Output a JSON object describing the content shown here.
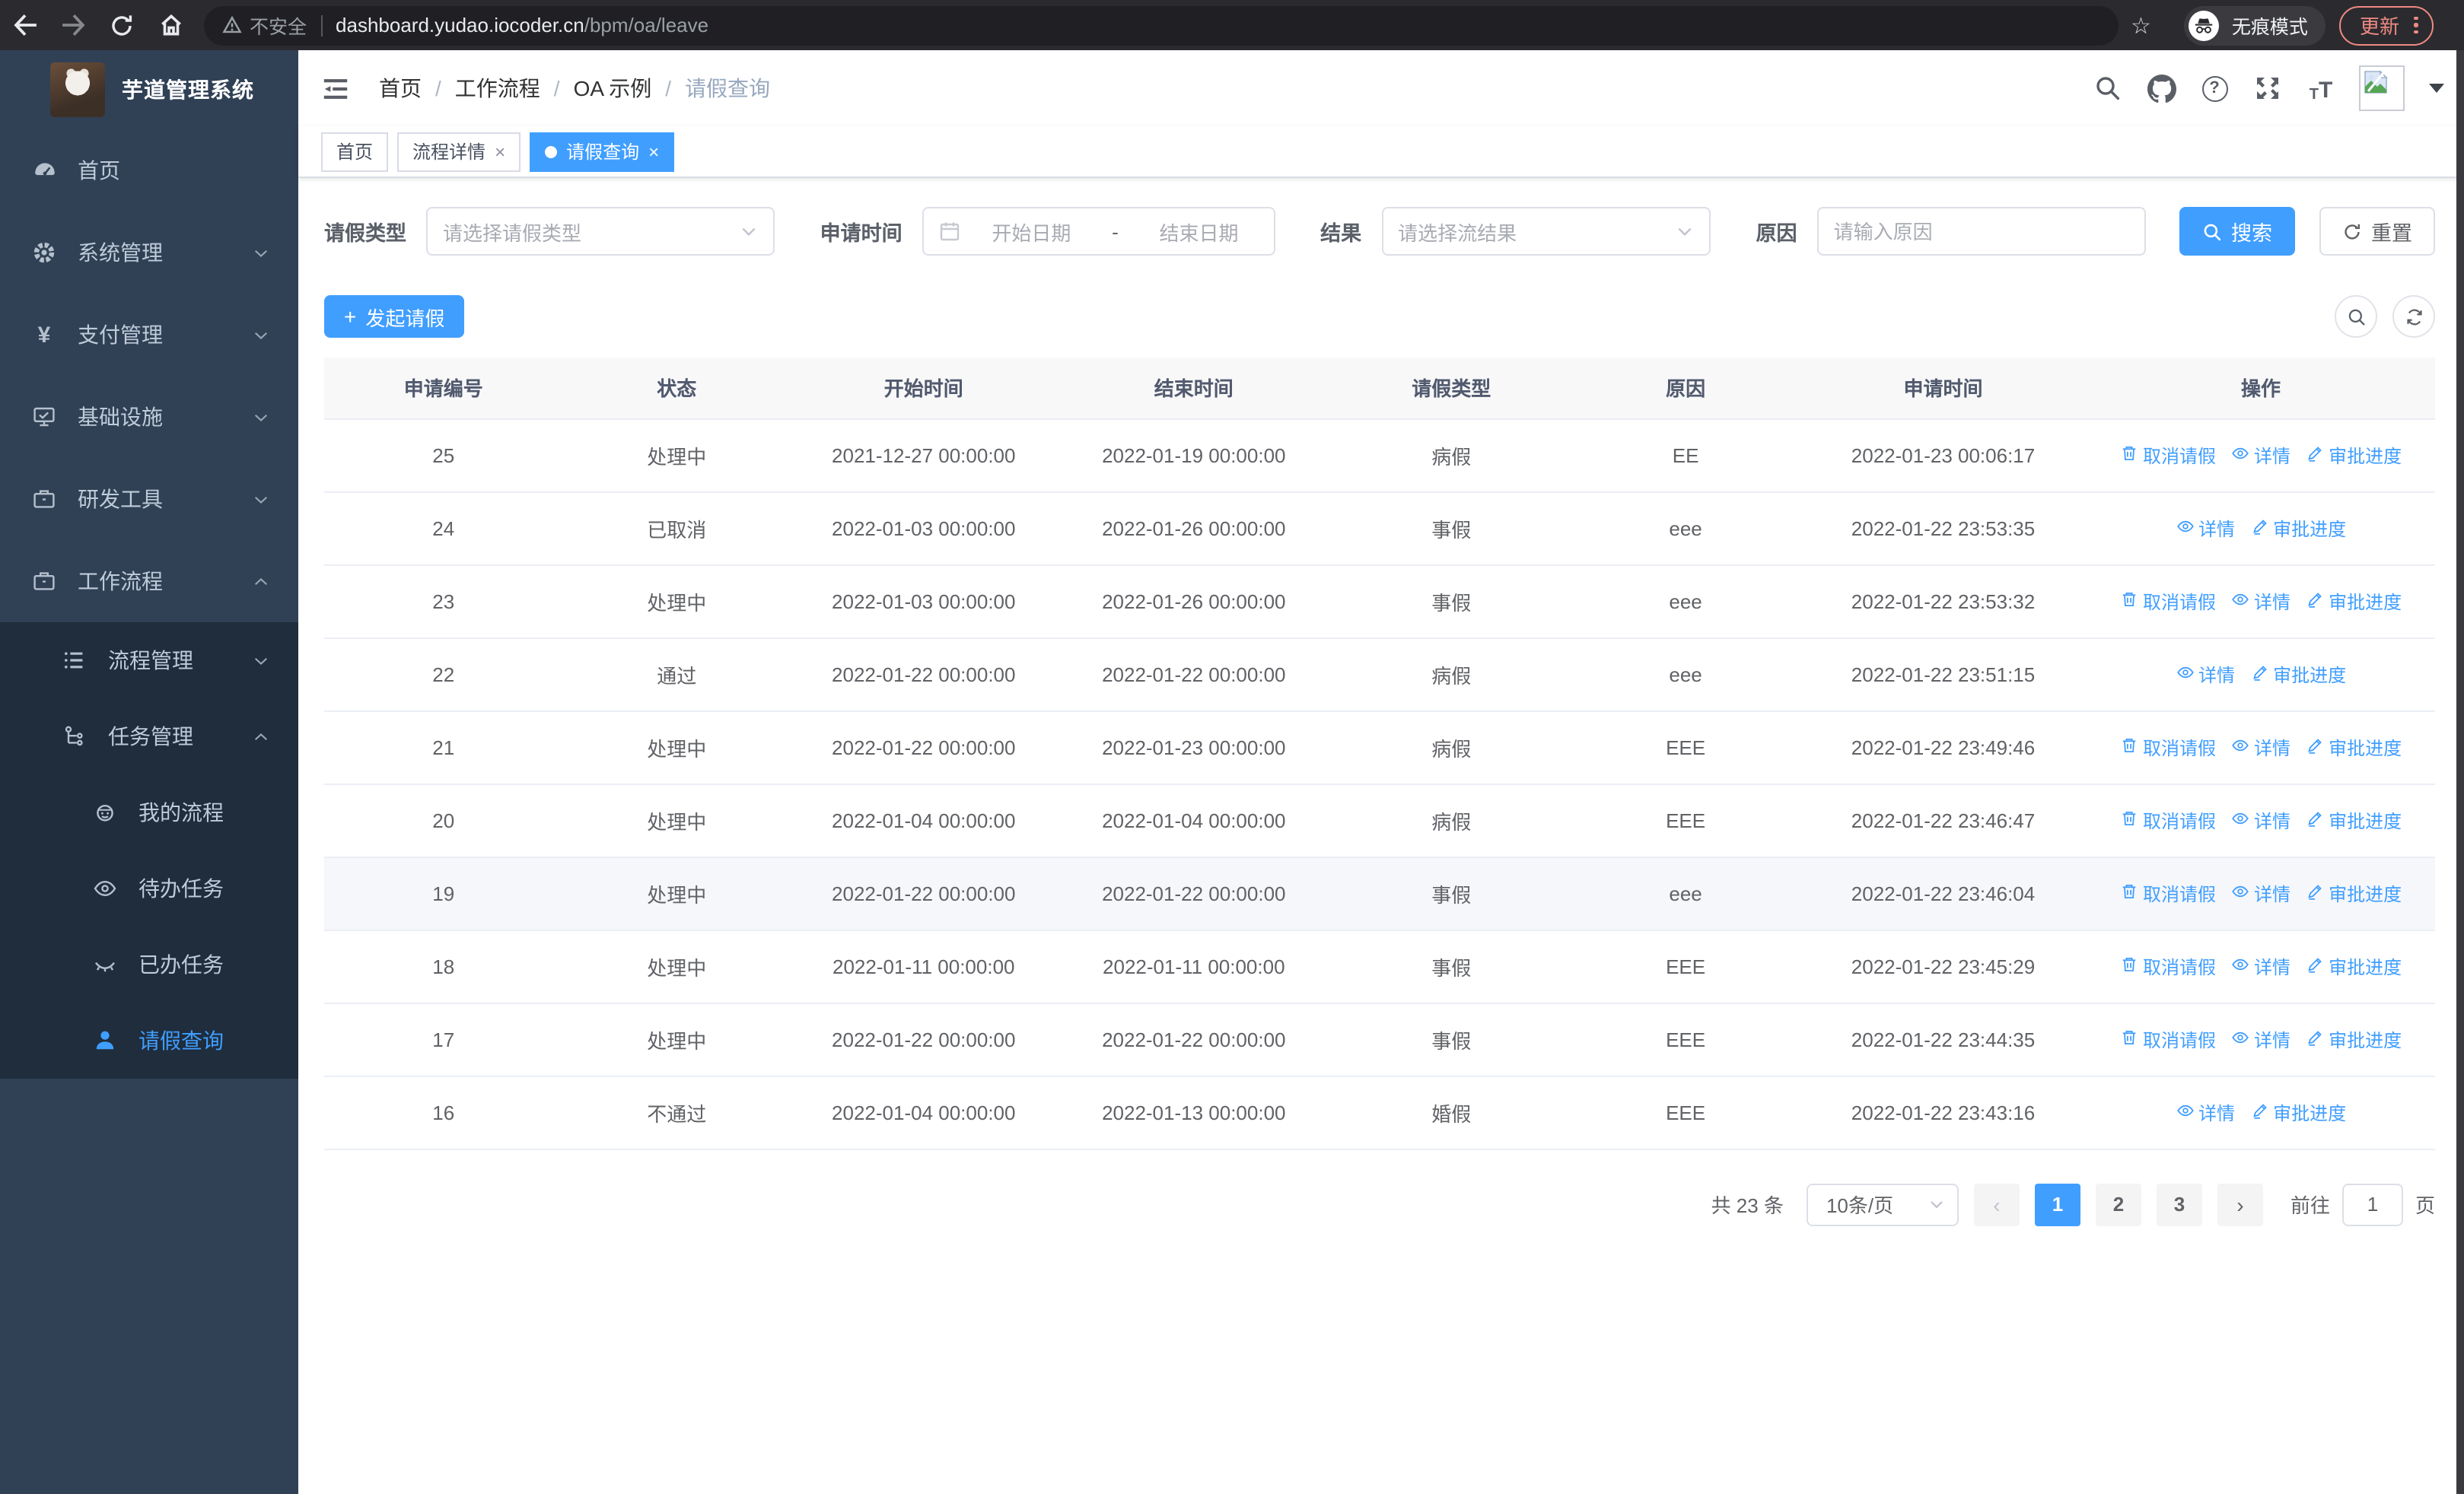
{
  "browser": {
    "security_label": "不安全",
    "url_host": "dashboard.yudao.iocoder.cn",
    "url_path": "/bpm/oa/leave",
    "incognito_label": "无痕模式",
    "update_label": "更新"
  },
  "sidebar": {
    "title": "芋道管理系统",
    "menu": [
      {
        "label": "首页",
        "icon": "dashboard-icon",
        "level": 1,
        "chevron": "",
        "in_submenu": false,
        "active": false
      },
      {
        "label": "系统管理",
        "icon": "gear-icon",
        "level": 1,
        "chevron": "down",
        "in_submenu": false,
        "active": false
      },
      {
        "label": "支付管理",
        "icon": "yen-icon",
        "level": 1,
        "chevron": "down",
        "in_submenu": false,
        "active": false
      },
      {
        "label": "基础设施",
        "icon": "monitor-icon",
        "level": 1,
        "chevron": "down",
        "in_submenu": false,
        "active": false
      },
      {
        "label": "研发工具",
        "icon": "briefcase-icon",
        "level": 1,
        "chevron": "down",
        "in_submenu": false,
        "active": false
      },
      {
        "label": "工作流程",
        "icon": "briefcase-icon",
        "level": 1,
        "chevron": "up",
        "in_submenu": false,
        "active": false
      },
      {
        "label": "流程管理",
        "icon": "list-icon",
        "level": 2,
        "chevron": "down",
        "in_submenu": true,
        "active": false
      },
      {
        "label": "任务管理",
        "icon": "flow-icon",
        "level": 2,
        "chevron": "up",
        "in_submenu": true,
        "active": false
      },
      {
        "label": "我的流程",
        "icon": "robot-icon",
        "level": 3,
        "chevron": "",
        "in_submenu": true,
        "active": false
      },
      {
        "label": "待办任务",
        "icon": "eye-open-icon",
        "level": 3,
        "chevron": "",
        "in_submenu": true,
        "active": false
      },
      {
        "label": "已办任务",
        "icon": "eye-closed-icon",
        "level": 3,
        "chevron": "",
        "in_submenu": true,
        "active": false
      },
      {
        "label": "请假查询",
        "icon": "user-icon",
        "level": 3,
        "chevron": "",
        "in_submenu": true,
        "active": true
      }
    ]
  },
  "header": {
    "breadcrumb": [
      "首页",
      "工作流程",
      "OA 示例",
      "请假查询"
    ]
  },
  "tabs": [
    {
      "label": "首页",
      "closable": false,
      "active": false
    },
    {
      "label": "流程详情",
      "closable": true,
      "active": false
    },
    {
      "label": "请假查询",
      "closable": true,
      "active": true
    }
  ],
  "filters": {
    "type_label": "请假类型",
    "type_placeholder": "请选择请假类型",
    "time_label": "申请时间",
    "date_start_placeholder": "开始日期",
    "date_separator": "-",
    "date_end_placeholder": "结束日期",
    "result_label": "结果",
    "result_placeholder": "请选择流结果",
    "reason_label": "原因",
    "reason_placeholder": "请输入原因",
    "search_label": "搜索",
    "reset_label": "重置"
  },
  "toolbar": {
    "create_label": "发起请假"
  },
  "table": {
    "columns": [
      "申请编号",
      "状态",
      "开始时间",
      "结束时间",
      "请假类型",
      "原因",
      "申请时间",
      "操作"
    ],
    "action_labels": {
      "cancel": "取消请假",
      "detail": "详情",
      "progress": "审批进度"
    },
    "rows": [
      {
        "id": "25",
        "status": "处理中",
        "start": "2021-12-27 00:00:00",
        "end": "2022-01-19 00:00:00",
        "type": "病假",
        "reason": "EE",
        "apply": "2022-01-23 00:06:17",
        "actions": [
          "cancel",
          "detail",
          "progress"
        ],
        "highlight": false
      },
      {
        "id": "24",
        "status": "已取消",
        "start": "2022-01-03 00:00:00",
        "end": "2022-01-26 00:00:00",
        "type": "事假",
        "reason": "eee",
        "apply": "2022-01-22 23:53:35",
        "actions": [
          "detail",
          "progress"
        ],
        "highlight": false
      },
      {
        "id": "23",
        "status": "处理中",
        "start": "2022-01-03 00:00:00",
        "end": "2022-01-26 00:00:00",
        "type": "事假",
        "reason": "eee",
        "apply": "2022-01-22 23:53:32",
        "actions": [
          "cancel",
          "detail",
          "progress"
        ],
        "highlight": false
      },
      {
        "id": "22",
        "status": "通过",
        "start": "2022-01-22 00:00:00",
        "end": "2022-01-22 00:00:00",
        "type": "病假",
        "reason": "eee",
        "apply": "2022-01-22 23:51:15",
        "actions": [
          "detail",
          "progress"
        ],
        "highlight": false
      },
      {
        "id": "21",
        "status": "处理中",
        "start": "2022-01-22 00:00:00",
        "end": "2022-01-23 00:00:00",
        "type": "病假",
        "reason": "EEE",
        "apply": "2022-01-22 23:49:46",
        "actions": [
          "cancel",
          "detail",
          "progress"
        ],
        "highlight": false
      },
      {
        "id": "20",
        "status": "处理中",
        "start": "2022-01-04 00:00:00",
        "end": "2022-01-04 00:00:00",
        "type": "病假",
        "reason": "EEE",
        "apply": "2022-01-22 23:46:47",
        "actions": [
          "cancel",
          "detail",
          "progress"
        ],
        "highlight": false
      },
      {
        "id": "19",
        "status": "处理中",
        "start": "2022-01-22 00:00:00",
        "end": "2022-01-22 00:00:00",
        "type": "事假",
        "reason": "eee",
        "apply": "2022-01-22 23:46:04",
        "actions": [
          "cancel",
          "detail",
          "progress"
        ],
        "highlight": true
      },
      {
        "id": "18",
        "status": "处理中",
        "start": "2022-01-11 00:00:00",
        "end": "2022-01-11 00:00:00",
        "type": "事假",
        "reason": "EEE",
        "apply": "2022-01-22 23:45:29",
        "actions": [
          "cancel",
          "detail",
          "progress"
        ],
        "highlight": false
      },
      {
        "id": "17",
        "status": "处理中",
        "start": "2022-01-22 00:00:00",
        "end": "2022-01-22 00:00:00",
        "type": "事假",
        "reason": "EEE",
        "apply": "2022-01-22 23:44:35",
        "actions": [
          "cancel",
          "detail",
          "progress"
        ],
        "highlight": false
      },
      {
        "id": "16",
        "status": "不通过",
        "start": "2022-01-04 00:00:00",
        "end": "2022-01-13 00:00:00",
        "type": "婚假",
        "reason": "EEE",
        "apply": "2022-01-22 23:43:16",
        "actions": [
          "detail",
          "progress"
        ],
        "highlight": false
      }
    ]
  },
  "pagination": {
    "total_label": "共 23 条",
    "page_size_value": "10条/页",
    "pages": [
      "1",
      "2",
      "3"
    ],
    "active_page": "1",
    "goto_label": "前往",
    "goto_value": "1",
    "page_suffix": "页",
    "accent_color": "#409eff"
  }
}
